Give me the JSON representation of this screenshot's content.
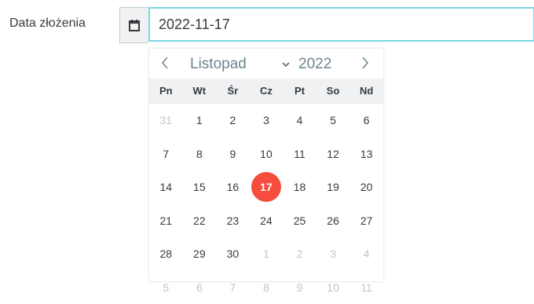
{
  "field": {
    "label": "Data złożenia",
    "value": "2022-11-17",
    "calendar_icon": "calendar-icon"
  },
  "picker": {
    "month": "Listopad",
    "year": "2022",
    "prev_icon": "chevron-left-icon",
    "next_icon": "chevron-right-icon",
    "year_icon": "chevron-down-icon",
    "weekdays": [
      "Pn",
      "Wt",
      "Śr",
      "Cz",
      "Pt",
      "So",
      "Nd"
    ],
    "weeks": [
      [
        {
          "d": "31",
          "m": true
        },
        {
          "d": "1"
        },
        {
          "d": "2"
        },
        {
          "d": "3"
        },
        {
          "d": "4"
        },
        {
          "d": "5"
        },
        {
          "d": "6"
        }
      ],
      [
        {
          "d": "7"
        },
        {
          "d": "8"
        },
        {
          "d": "9"
        },
        {
          "d": "10"
        },
        {
          "d": "11"
        },
        {
          "d": "12"
        },
        {
          "d": "13"
        }
      ],
      [
        {
          "d": "14"
        },
        {
          "d": "15"
        },
        {
          "d": "16"
        },
        {
          "d": "17",
          "s": true
        },
        {
          "d": "18"
        },
        {
          "d": "19"
        },
        {
          "d": "20"
        }
      ],
      [
        {
          "d": "21"
        },
        {
          "d": "22"
        },
        {
          "d": "23"
        },
        {
          "d": "24"
        },
        {
          "d": "25"
        },
        {
          "d": "26"
        },
        {
          "d": "27"
        }
      ],
      [
        {
          "d": "28"
        },
        {
          "d": "29"
        },
        {
          "d": "30"
        },
        {
          "d": "1",
          "m": true
        },
        {
          "d": "2",
          "m": true
        },
        {
          "d": "3",
          "m": true
        },
        {
          "d": "4",
          "m": true
        }
      ],
      [
        {
          "d": "5",
          "m": true
        },
        {
          "d": "6",
          "m": true
        },
        {
          "d": "7",
          "m": true
        },
        {
          "d": "8",
          "m": true
        },
        {
          "d": "9",
          "m": true
        },
        {
          "d": "10",
          "m": true
        },
        {
          "d": "11",
          "m": true
        }
      ]
    ],
    "selected_color": "#f54c3e"
  }
}
